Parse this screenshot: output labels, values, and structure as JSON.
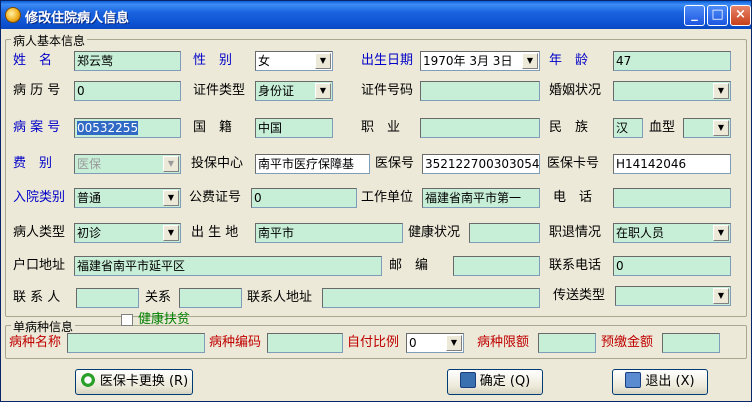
{
  "window": {
    "title": "修改住院病人信息"
  },
  "basic": {
    "legend": "病人基本信息",
    "name_label": "姓　名",
    "name": "郑云莺",
    "sex_label": "性　别",
    "sex": "女",
    "birth_label": "出生日期",
    "birth": "1970年 3月 3日",
    "age_label": "年　龄",
    "age": "47",
    "record_label": "病 历 号",
    "record": "0",
    "idtype_label": "证件类型",
    "idtype": "身份证",
    "idno_label": "证件号码",
    "idno": "",
    "marital_label": "婚姻状况",
    "marital": "",
    "case_label": "病 案 号",
    "case": "00532255",
    "nation_label": "国　籍",
    "nation": "中国",
    "job_label": "职　业",
    "job": "",
    "ethnic_label": "民　族",
    "ethnic": "汉",
    "blood_label": "血型",
    "blood": "",
    "fee_label": "费　别",
    "fee": "医保",
    "insurer_label": "投保中心",
    "insurer": "南平市医疗保障基",
    "insno_label": "医保号",
    "insno": "352122700303054",
    "card_label": "医保卡号",
    "card": "H14142046",
    "admit_label": "入院类别",
    "admit": "普通",
    "public_label": "公费证号",
    "public": "0",
    "work_label": "工作单位",
    "work": "福建省南平市第一",
    "phone_label": "电　话",
    "phone": "",
    "ptype_label": "病人类型",
    "ptype": "初诊",
    "birthplace_label": "出 生 地",
    "birthplace": "南平市",
    "health_label": "健康状况",
    "health": "",
    "retire_label": "职退情况",
    "retire": "在职人员",
    "address_label": "户口地址",
    "address": "福建省南平市延平区",
    "zip_label": "邮　编",
    "zip": "",
    "contact_phone_label": "联系电话",
    "contact_phone": "0",
    "contact_label": "联 系 人",
    "contact": "",
    "relation_label": "关系",
    "relation": "",
    "contact_addr_label": "联系人地址",
    "contact_addr": "",
    "send_label": "传送类型",
    "send": ""
  },
  "disease": {
    "legend": "单病种信息",
    "health_aid_label": "健康扶贫",
    "dname_label": "病种名称",
    "dname": "",
    "dcode_label": "病种编码",
    "dcode": "",
    "ratio_label": "自付比例",
    "ratio": "0",
    "limit_label": "病种限额",
    "limit": "",
    "deposit_label": "预缴金额",
    "deposit": ""
  },
  "buttons": {
    "change_card": "医保卡更换 (R)",
    "ok": "确定 (Q)",
    "exit": "退出 (X)"
  },
  "icons": {
    "dropdown": "chevron-down-icon"
  }
}
